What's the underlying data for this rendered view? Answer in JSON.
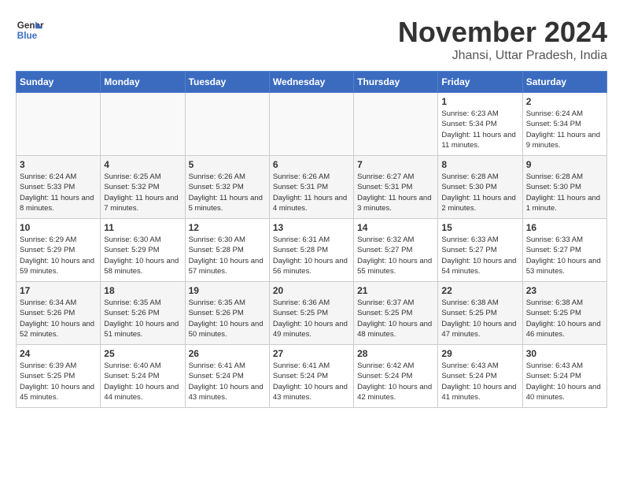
{
  "logo": {
    "line1": "General",
    "line2": "Blue"
  },
  "title": "November 2024",
  "subtitle": "Jhansi, Uttar Pradesh, India",
  "days_of_week": [
    "Sunday",
    "Monday",
    "Tuesday",
    "Wednesday",
    "Thursday",
    "Friday",
    "Saturday"
  ],
  "weeks": [
    [
      {
        "day": "",
        "info": ""
      },
      {
        "day": "",
        "info": ""
      },
      {
        "day": "",
        "info": ""
      },
      {
        "day": "",
        "info": ""
      },
      {
        "day": "",
        "info": ""
      },
      {
        "day": "1",
        "info": "Sunrise: 6:23 AM\nSunset: 5:34 PM\nDaylight: 11 hours and 11 minutes."
      },
      {
        "day": "2",
        "info": "Sunrise: 6:24 AM\nSunset: 5:34 PM\nDaylight: 11 hours and 9 minutes."
      }
    ],
    [
      {
        "day": "3",
        "info": "Sunrise: 6:24 AM\nSunset: 5:33 PM\nDaylight: 11 hours and 8 minutes."
      },
      {
        "day": "4",
        "info": "Sunrise: 6:25 AM\nSunset: 5:32 PM\nDaylight: 11 hours and 7 minutes."
      },
      {
        "day": "5",
        "info": "Sunrise: 6:26 AM\nSunset: 5:32 PM\nDaylight: 11 hours and 5 minutes."
      },
      {
        "day": "6",
        "info": "Sunrise: 6:26 AM\nSunset: 5:31 PM\nDaylight: 11 hours and 4 minutes."
      },
      {
        "day": "7",
        "info": "Sunrise: 6:27 AM\nSunset: 5:31 PM\nDaylight: 11 hours and 3 minutes."
      },
      {
        "day": "8",
        "info": "Sunrise: 6:28 AM\nSunset: 5:30 PM\nDaylight: 11 hours and 2 minutes."
      },
      {
        "day": "9",
        "info": "Sunrise: 6:28 AM\nSunset: 5:30 PM\nDaylight: 11 hours and 1 minute."
      }
    ],
    [
      {
        "day": "10",
        "info": "Sunrise: 6:29 AM\nSunset: 5:29 PM\nDaylight: 10 hours and 59 minutes."
      },
      {
        "day": "11",
        "info": "Sunrise: 6:30 AM\nSunset: 5:29 PM\nDaylight: 10 hours and 58 minutes."
      },
      {
        "day": "12",
        "info": "Sunrise: 6:30 AM\nSunset: 5:28 PM\nDaylight: 10 hours and 57 minutes."
      },
      {
        "day": "13",
        "info": "Sunrise: 6:31 AM\nSunset: 5:28 PM\nDaylight: 10 hours and 56 minutes."
      },
      {
        "day": "14",
        "info": "Sunrise: 6:32 AM\nSunset: 5:27 PM\nDaylight: 10 hours and 55 minutes."
      },
      {
        "day": "15",
        "info": "Sunrise: 6:33 AM\nSunset: 5:27 PM\nDaylight: 10 hours and 54 minutes."
      },
      {
        "day": "16",
        "info": "Sunrise: 6:33 AM\nSunset: 5:27 PM\nDaylight: 10 hours and 53 minutes."
      }
    ],
    [
      {
        "day": "17",
        "info": "Sunrise: 6:34 AM\nSunset: 5:26 PM\nDaylight: 10 hours and 52 minutes."
      },
      {
        "day": "18",
        "info": "Sunrise: 6:35 AM\nSunset: 5:26 PM\nDaylight: 10 hours and 51 minutes."
      },
      {
        "day": "19",
        "info": "Sunrise: 6:35 AM\nSunset: 5:26 PM\nDaylight: 10 hours and 50 minutes."
      },
      {
        "day": "20",
        "info": "Sunrise: 6:36 AM\nSunset: 5:25 PM\nDaylight: 10 hours and 49 minutes."
      },
      {
        "day": "21",
        "info": "Sunrise: 6:37 AM\nSunset: 5:25 PM\nDaylight: 10 hours and 48 minutes."
      },
      {
        "day": "22",
        "info": "Sunrise: 6:38 AM\nSunset: 5:25 PM\nDaylight: 10 hours and 47 minutes."
      },
      {
        "day": "23",
        "info": "Sunrise: 6:38 AM\nSunset: 5:25 PM\nDaylight: 10 hours and 46 minutes."
      }
    ],
    [
      {
        "day": "24",
        "info": "Sunrise: 6:39 AM\nSunset: 5:25 PM\nDaylight: 10 hours and 45 minutes."
      },
      {
        "day": "25",
        "info": "Sunrise: 6:40 AM\nSunset: 5:24 PM\nDaylight: 10 hours and 44 minutes."
      },
      {
        "day": "26",
        "info": "Sunrise: 6:41 AM\nSunset: 5:24 PM\nDaylight: 10 hours and 43 minutes."
      },
      {
        "day": "27",
        "info": "Sunrise: 6:41 AM\nSunset: 5:24 PM\nDaylight: 10 hours and 43 minutes."
      },
      {
        "day": "28",
        "info": "Sunrise: 6:42 AM\nSunset: 5:24 PM\nDaylight: 10 hours and 42 minutes."
      },
      {
        "day": "29",
        "info": "Sunrise: 6:43 AM\nSunset: 5:24 PM\nDaylight: 10 hours and 41 minutes."
      },
      {
        "day": "30",
        "info": "Sunrise: 6:43 AM\nSunset: 5:24 PM\nDaylight: 10 hours and 40 minutes."
      }
    ]
  ]
}
